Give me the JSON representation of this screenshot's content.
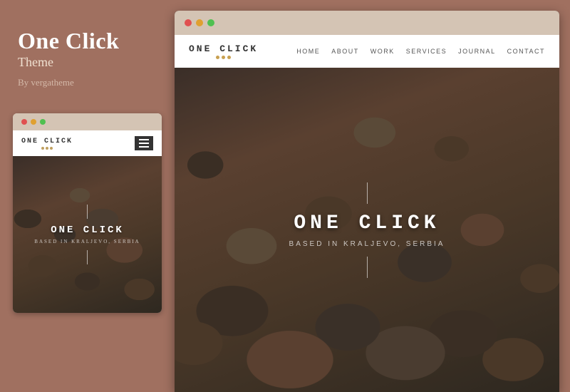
{
  "sidebar": {
    "title": "One Click",
    "subtitle": "Theme",
    "author": "By vergatheme"
  },
  "mobile_preview": {
    "browser_dots": [
      "red",
      "yellow",
      "green"
    ],
    "logo": "ONE CLICK",
    "logo_dots": 3,
    "hero_title": "ONE CLICK",
    "hero_subtitle": "BASED IN KRALJEVO, SERBIA"
  },
  "desktop_preview": {
    "browser_dots": [
      "red",
      "yellow",
      "green"
    ],
    "nav": {
      "logo": "ONE CLICK",
      "logo_dots": 3,
      "links": [
        "HOME",
        "ABOUT",
        "WORK",
        "SERVICES",
        "JOURNAL",
        "CONTACT"
      ]
    },
    "hero": {
      "title": "ONE CLICK",
      "subtitle": "BASED IN KRALJEVO, SERBIA"
    }
  }
}
